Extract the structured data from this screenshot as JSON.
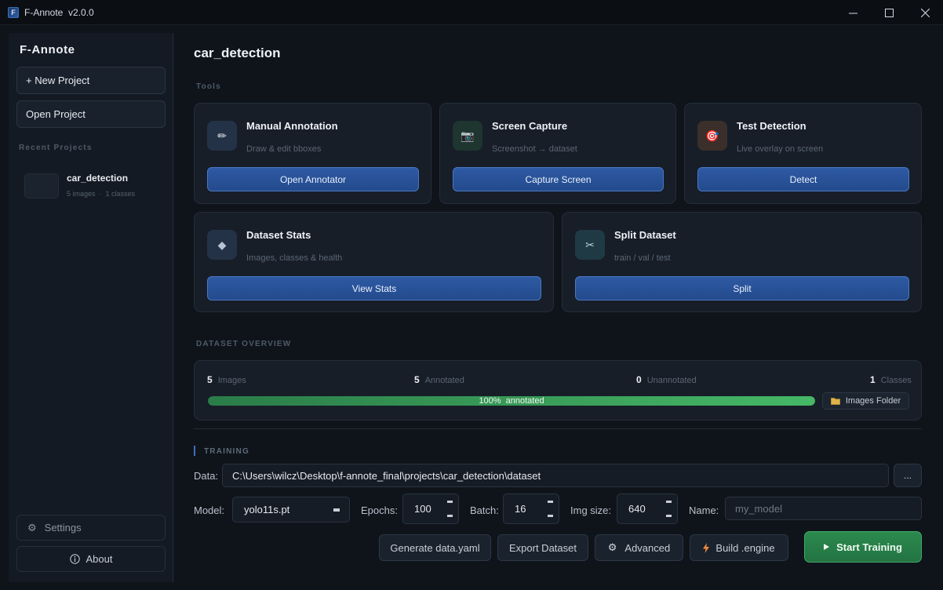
{
  "window": {
    "title": "F-Annote  v2.0.0",
    "controls": [
      "minimize-icon",
      "maximize-icon",
      "close-icon"
    ]
  },
  "sidebar": {
    "brand": "F-Annote",
    "new_project": "+ New Project",
    "open_project": "Open Project",
    "recent_label": "Recent Projects",
    "recent": [
      {
        "name": "car_detection",
        "meta": "5 images  ·  1 classes"
      }
    ],
    "settings": "Settings",
    "about": "About"
  },
  "main": {
    "title": "car_detection",
    "tools_label": "Tools",
    "tools": [
      {
        "title": "Manual Annotation",
        "subtitle": "Draw & edit bboxes",
        "button": "Open Annotator",
        "icon": "pencil-icon",
        "icon_glyph": "✏"
      },
      {
        "title": "Screen Capture",
        "subtitle": "Screenshot → dataset",
        "button": "Capture Screen",
        "icon": "camera-icon",
        "icon_glyph": "📷"
      },
      {
        "title": "Test Detection",
        "subtitle": "Live overlay on screen",
        "button": "Detect",
        "icon": "target-icon",
        "icon_glyph": "🎯"
      },
      {
        "title": "Dataset Stats",
        "subtitle": "Images, classes & health",
        "button": "View Stats",
        "icon": "diamond-icon",
        "icon_glyph": "◆"
      },
      {
        "title": "Split Dataset",
        "subtitle": "train / val / test",
        "button": "Split",
        "icon": "scissors-icon",
        "icon_glyph": "✂"
      }
    ],
    "overview_label": "DATASET OVERVIEW",
    "overview": {
      "images": {
        "value": "5",
        "label": "Images"
      },
      "annotated": {
        "value": "5",
        "label": "Annotated"
      },
      "unannotated": {
        "value": "0",
        "label": "Unannotated"
      },
      "classes": {
        "value": "1",
        "label": "Classes"
      },
      "progress_fraction": 1.0,
      "progress_text": "100%  annotated",
      "folder_button": "Images Folder"
    },
    "training_label": "TRAINING",
    "training": {
      "data_label": "Data:",
      "data_path": "C:\\Users\\wilcz\\Desktop\\f-annote_final\\projects\\car_detection\\dataset",
      "browse_button": "...",
      "model_label": "Model:",
      "model_value": "yolo11s.pt",
      "epochs_label": "Epochs:",
      "epochs_value": "100",
      "batch_label": "Batch:",
      "batch_value": "16",
      "imgsize_label": "Img size:",
      "imgsize_value": "640",
      "name_label": "Name:",
      "name_placeholder": "my_model",
      "generate_yaml": "Generate data.yaml",
      "export_dataset": "Export Dataset",
      "advanced": "Advanced",
      "build_engine": "Build .engine",
      "start_training": "Start Training"
    }
  },
  "colors": {
    "accent_blue": "#2e5aa4",
    "accent_green": "#2b8a4e",
    "background": "#0f141b"
  }
}
